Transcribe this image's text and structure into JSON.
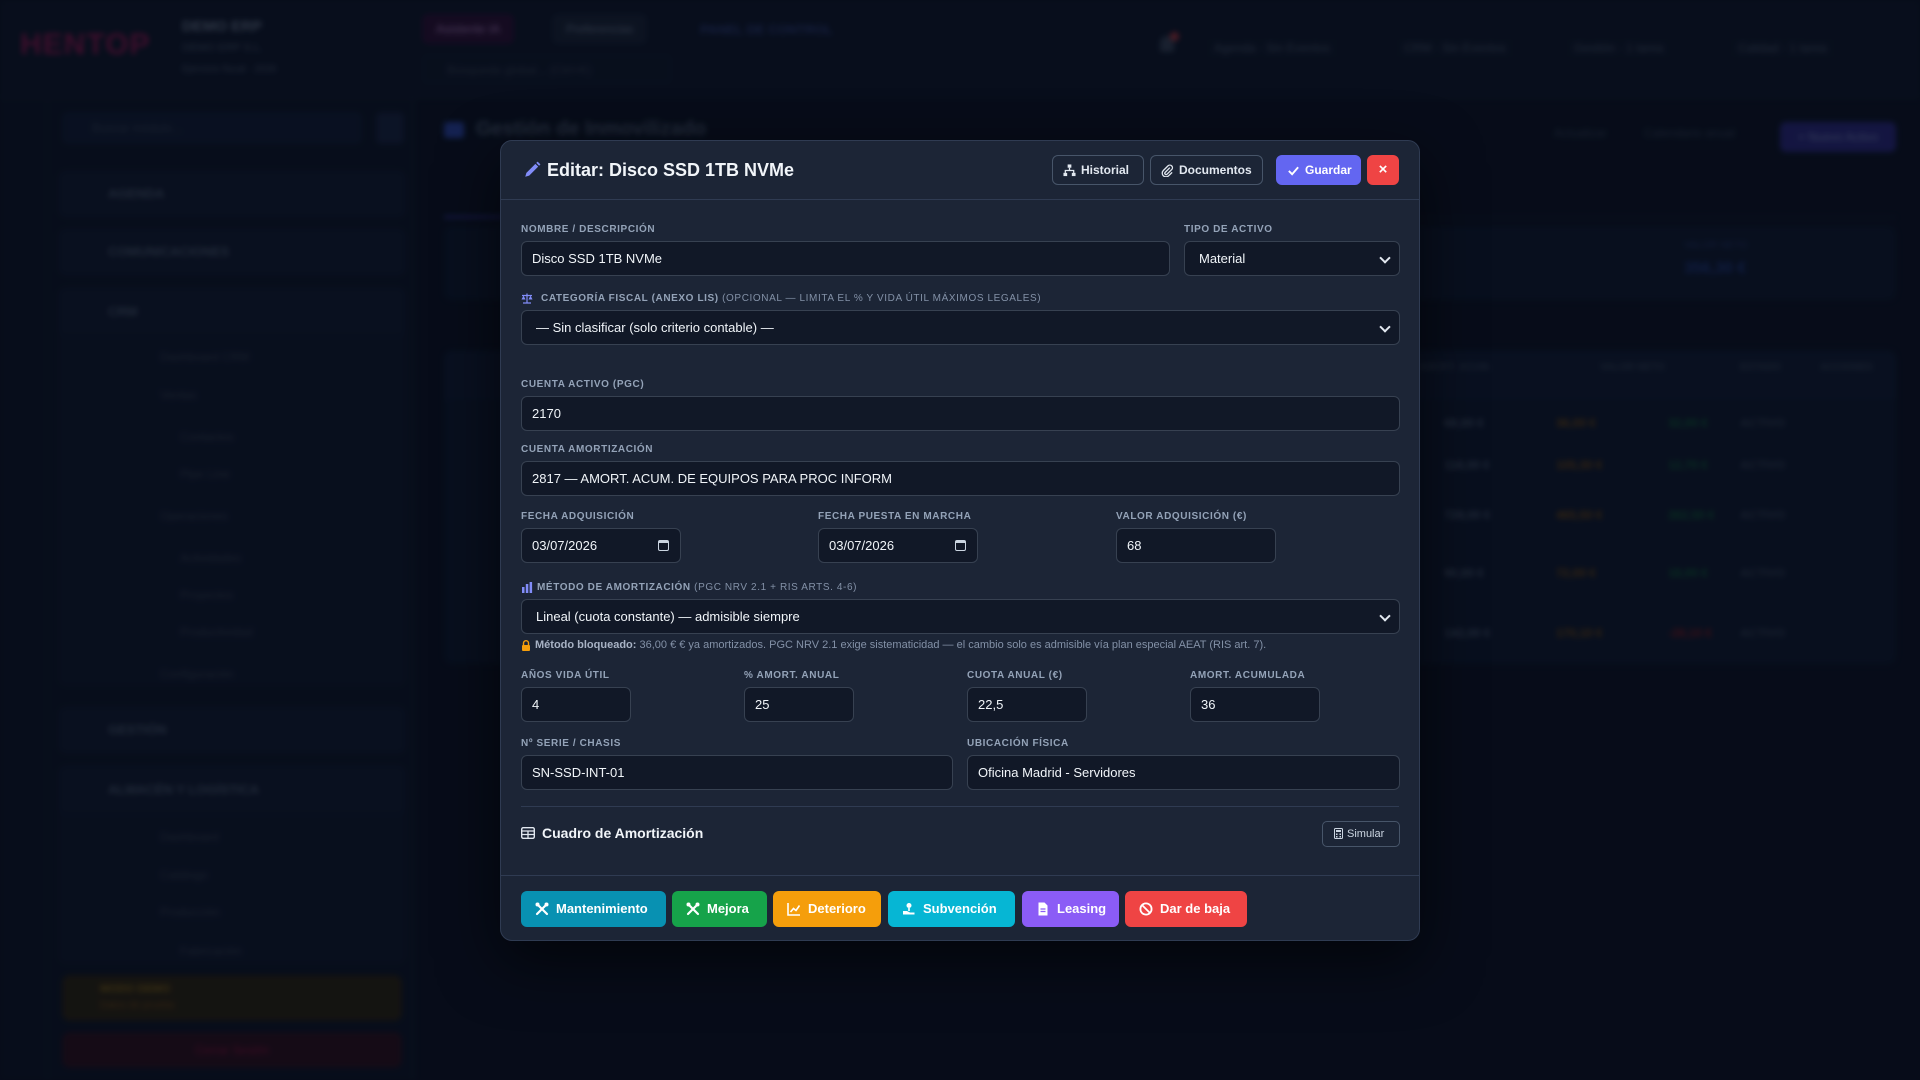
{
  "app": {
    "logo": "HENTOP",
    "company_name": "DEMO ERP",
    "company_sub": "DEMO ERP S.L.",
    "company_sub2": "Ejercicio fiscal · 2026",
    "ai_button": "Asistente IA",
    "prefs_button": "Preferencias",
    "global_search_placeholder": "Búsqueda global... (Ctrl+K)",
    "panel_label": "PANEL DE CONTROL",
    "top_stats": [
      "Agenda · Sin Eventos",
      "CRM · Sin Eventos",
      "Gestión · 1 tarea",
      "Calidad · 1 tarea"
    ]
  },
  "sidebar": {
    "search_placeholder": "Buscar módulo...",
    "sections": [
      "AGENDA",
      "COMUNICACIONES",
      "CRM",
      "GESTIÓN",
      "ALMACÉN Y LOGÍSTICA"
    ],
    "crm_items": [
      "Dashboard CRM",
      "Ventas",
      "Contactos",
      "Pipe Line",
      "Operaciones",
      "Actividades",
      "Proyectos",
      "Productividad",
      "Configuración"
    ],
    "almacen_items": [
      "Dashboard",
      "Catálogo",
      "Producción",
      "Fabricación"
    ],
    "demo_title": "MODO DEMO",
    "demo_sub": "Datos de prueba",
    "logout": "Cerrar Sesión"
  },
  "page": {
    "title": "Gestión de Inmovilizado",
    "refresh": "Actualizar",
    "calendar": "Calendario anual",
    "new_asset": "+ Nuevo Activo",
    "stat_label": "VALOR NETO",
    "stat_value": "356,30 €",
    "columns": [
      "AMORT. ACUM.",
      "VALOR NETO",
      "ESTADO",
      "ACCIONES"
    ],
    "rows": [
      {
        "a": "68,00 €",
        "b": "36,00 €",
        "c": "32,00 €",
        "d": "ACTIVO"
      },
      {
        "a": "118,00 €",
        "b": "105,30 €",
        "c": "12,70 €",
        "d": "ACTIVO"
      },
      {
        "a": "728,00 €",
        "b": "465,50 €",
        "c": "262,50 €",
        "d": "ACTIVO"
      },
      {
        "a": "90,00 €",
        "b": "72,00 €",
        "c": "18,00 €",
        "d": "ACTIVO"
      },
      {
        "a": "142,00 €",
        "b": "170,10 €",
        "c": "-28,10 €",
        "d": "ACTIVO"
      }
    ]
  },
  "modal": {
    "title": "Editar: Disco SSD 1TB NVMe",
    "buttons": {
      "historial": "Historial",
      "documentos": "Documentos",
      "guardar": "Guardar",
      "close": "×"
    },
    "fields": {
      "nombre_label": "NOMBRE / DESCRIPCIÓN",
      "nombre_value": "Disco SSD 1TB NVMe",
      "tipo_label": "TIPO DE ACTIVO",
      "tipo_value": "Material",
      "categoria_label": "CATEGORÍA FISCAL (ANEXO LIS)",
      "categoria_note": "(OPCIONAL — LIMITA EL % Y VIDA ÚTIL MÁXIMOS LEGALES)",
      "categoria_value": "— Sin clasificar (solo criterio contable) —",
      "cuenta_activo_label": "CUENTA ACTIVO (PGC)",
      "cuenta_activo_value": "2170",
      "cuenta_amort_label": "CUENTA AMORTIZACIÓN",
      "cuenta_amort_value": "2817 — AMORT. ACUM. DE EQUIPOS PARA PROC INFORM",
      "fecha_adq_label": "FECHA ADQUISICIÓN",
      "fecha_adq_value": "03/07/2026",
      "fecha_marcha_label": "FECHA PUESTA EN MARCHA",
      "fecha_marcha_value": "03/07/2026",
      "valor_adq_label": "VALOR ADQUISICIÓN (€)",
      "valor_adq_value": "68",
      "metodo_label": "MÉTODO DE AMORTIZACIÓN",
      "metodo_note": "(PGC NRV 2.1 + RIS ARTS. 4-6)",
      "metodo_value": "Lineal (cuota constante) — admisible siempre",
      "bloqueo_bold": "Método bloqueado:",
      "bloqueo_text": "36,00 € € ya amortizados. PGC NRV 2.1 exige sistematicidad — el cambio solo es admisible vía plan especial AEAT (RIS art. 7).",
      "anos_label": "AÑOS VIDA ÚTIL",
      "anos_value": "4",
      "pct_label": "% AMORT. ANUAL",
      "pct_value": "25",
      "cuota_label": "CUOTA ANUAL (€)",
      "cuota_value": "22,5",
      "acum_label": "AMORT. ACUMULADA",
      "acum_value": "36",
      "serie_label": "Nº SERIE / CHASIS",
      "serie_value": "SN-SSD-INT-01",
      "ubicacion_label": "UBICACIÓN FÍSICA",
      "ubicacion_value": "Oficina Madrid - Servidores"
    },
    "cuadro_title": "Cuadro de Amortización",
    "simular": "Simular",
    "footer": {
      "mantenimiento": "Mantenimiento",
      "mejora": "Mejora",
      "deterioro": "Deterioro",
      "subvencion": "Subvención",
      "leasing": "Leasing",
      "baja": "Dar de baja"
    }
  },
  "colors": {
    "accent": "#6366f1",
    "danger": "#ef4444",
    "modal_bg": "#1c2536",
    "input_bg": "#111827"
  }
}
